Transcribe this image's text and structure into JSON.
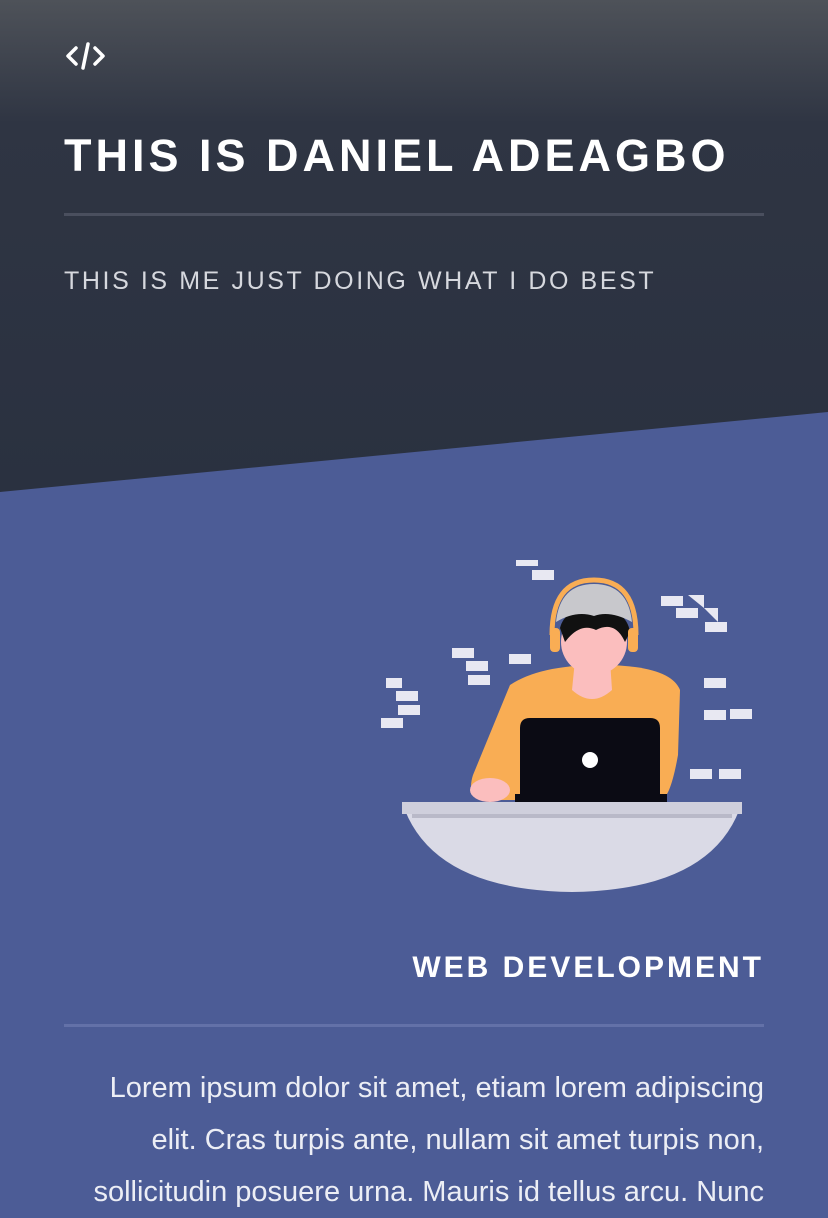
{
  "header": {
    "logo_icon": "code-icon",
    "title": "THIS IS DANIEL ADEAGBO",
    "subtitle": "THIS IS ME JUST DOING WHAT I DO BEST"
  },
  "section": {
    "illustration": "developer-at-laptop-illustration",
    "title": "WEB DEVELOPMENT",
    "body": "Lorem ipsum dolor sit amet, etiam lorem adipiscing elit. Cras turpis ante, nullam sit amet turpis non, sollicitudin posuere urna. Mauris id tellus arcu. Nunc"
  },
  "colors": {
    "header_dark": "#2a3140",
    "section_blue": "#4c5c96",
    "accent_orange": "#f9ad54",
    "laptop": "#0b0b14"
  }
}
